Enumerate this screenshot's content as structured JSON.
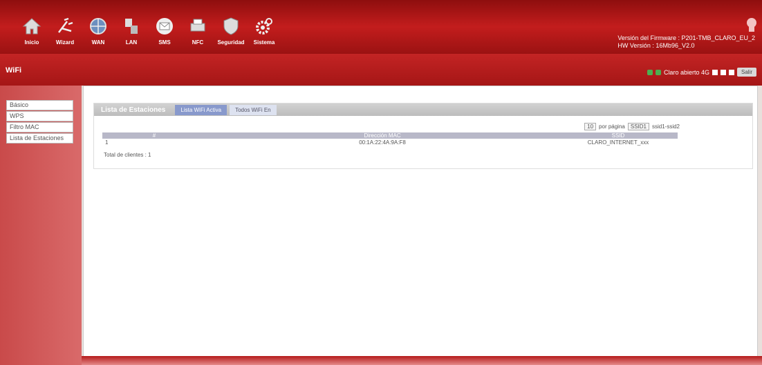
{
  "nav": [
    {
      "label": "Inicio",
      "icon": "home-icon"
    },
    {
      "label": "Wizard",
      "icon": "wizard-icon"
    },
    {
      "label": "WAN",
      "icon": "globe-icon"
    },
    {
      "label": "LAN",
      "icon": "lan-icon"
    },
    {
      "label": "SMS",
      "icon": "mail-icon"
    },
    {
      "label": "NFC",
      "icon": "printer-icon"
    },
    {
      "label": "Seguridad",
      "icon": "shield-icon"
    },
    {
      "label": "Sistema",
      "icon": "gear-icon"
    }
  ],
  "device": {
    "firmware": "Versión del Firmware : P201-TMB_CLARO_EU_2",
    "version": "HW Versión : 16Mb96_V2.0"
  },
  "section": {
    "title": "WiFi"
  },
  "status": {
    "text": "Claro abierto 4G",
    "logout": "Salir"
  },
  "sidebar": {
    "items": [
      {
        "label": "Básico"
      },
      {
        "label": "WPS"
      },
      {
        "label": "Filtro MAC"
      },
      {
        "label": "Lista de Estaciones"
      }
    ]
  },
  "panel": {
    "title": "Lista de Estaciones",
    "tabs": [
      {
        "label": "Lista WiFi Activa",
        "active": true
      },
      {
        "label": "Todos WiFi En",
        "active": false
      }
    ]
  },
  "controls": {
    "per_page_value": "10",
    "per_page_label": "por página",
    "filter_value": "SSID1",
    "filter_label": "ssid1-ssid2"
  },
  "table": {
    "columns": [
      "#",
      "Dirección MAC",
      "SSID"
    ],
    "rows": [
      {
        "index": "1",
        "mac": "00:1A:22:4A:9A:F8",
        "ssid": "CLARO_INTERNET_xxx"
      }
    ],
    "total_label": "Total de clientes : 1"
  }
}
